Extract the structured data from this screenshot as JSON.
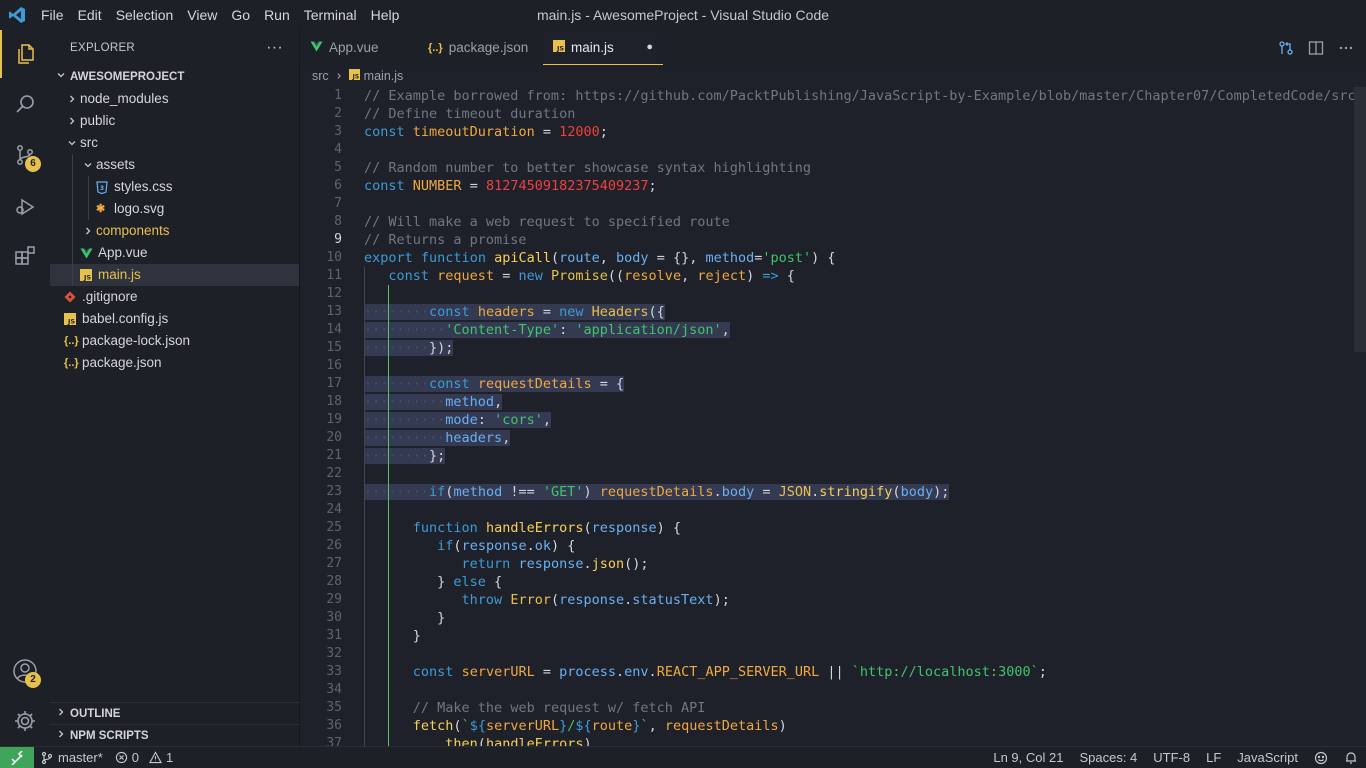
{
  "titlebar": {
    "menus": [
      "File",
      "Edit",
      "Selection",
      "View",
      "Go",
      "Run",
      "Terminal",
      "Help"
    ],
    "title": "main.js - AwesomeProject - Visual Studio Code"
  },
  "activity": {
    "scm_badge": "6",
    "accounts_badge": "2"
  },
  "sidebar": {
    "title": "EXPLORER",
    "more": "···",
    "project": "AWESOMEPROJECT",
    "tree": [
      {
        "label": "node_modules"
      },
      {
        "label": "public"
      },
      {
        "label": "src"
      },
      {
        "label": "assets"
      },
      {
        "label": "styles.css"
      },
      {
        "label": "logo.svg"
      },
      {
        "label": "components"
      },
      {
        "label": "App.vue"
      },
      {
        "label": "main.js"
      },
      {
        "label": ".gitignore"
      },
      {
        "label": "babel.config.js"
      },
      {
        "label": "package-lock.json"
      },
      {
        "label": "package.json"
      }
    ],
    "outline": "OUTLINE",
    "npm": "NPM SCRIPTS"
  },
  "tabs": [
    {
      "label": "App.vue"
    },
    {
      "label": "package.json"
    },
    {
      "label": "main.js",
      "dirty": "●"
    }
  ],
  "breadcrumb": {
    "folder": "src",
    "file": "main.js"
  },
  "status": {
    "branch": "master*",
    "errors": "0",
    "warnings": "1",
    "position": "Ln 9, Col 21",
    "spaces": "Spaces: 4",
    "encoding": "UTF-8",
    "eol": "LF",
    "language": "JavaScript"
  },
  "colors": {
    "accent": "#e7c14a",
    "remote": "#3fa55a",
    "background": "#1e2129"
  },
  "code": [
    [
      [
        "c-com",
        "// Example borrowed from: https://github.com/PacktPublishing/JavaScript-by-Example/blob/master/Chapter07/CompletedCode/src/se"
      ]
    ],
    [
      [
        "c-com",
        "// Define timeout duration"
      ]
    ],
    [
      [
        "c-kw",
        "const"
      ],
      [
        "",
        " "
      ],
      [
        "c-var",
        "timeoutDuration"
      ],
      [
        "",
        " = "
      ],
      [
        "c-num",
        "12000"
      ],
      [
        "",
        ";"
      ]
    ],
    [],
    [
      [
        "c-com",
        "// Random number to better showcase syntax highlighting"
      ]
    ],
    [
      [
        "c-kw",
        "const"
      ],
      [
        "",
        " "
      ],
      [
        "c-var",
        "NUMBER"
      ],
      [
        "",
        " = "
      ],
      [
        "c-num",
        "812745091823754092З7"
      ]
    ],
    [],
    [
      [
        "c-com",
        "// Will make a web request to specified route"
      ]
    ],
    [
      [
        "c-com",
        "// Returns a promise"
      ]
    ],
    [
      [
        "c-kw",
        "export"
      ],
      [
        "",
        " "
      ],
      [
        "c-kw",
        "function"
      ],
      [
        "",
        " "
      ],
      [
        "c-fn",
        "apiCall"
      ],
      [
        "",
        "("
      ],
      [
        "c-prop",
        "route"
      ],
      [
        "",
        ", "
      ],
      [
        "c-prop",
        "body"
      ],
      [
        "",
        " = {}, "
      ],
      [
        "c-prop",
        "method"
      ],
      [
        "",
        "="
      ],
      [
        "c-str",
        "'post'"
      ],
      [
        "",
        ") {"
      ]
    ],
    [
      [
        "",
        "   "
      ],
      [
        "c-kw",
        "const"
      ],
      [
        "",
        " "
      ],
      [
        "c-var",
        "request"
      ],
      [
        "",
        " = "
      ],
      [
        "c-kw",
        "new"
      ],
      [
        "",
        " "
      ],
      [
        "c-cls",
        "Promise"
      ],
      [
        "",
        "(("
      ],
      [
        "c-var",
        "resolve"
      ],
      [
        "",
        ", "
      ],
      [
        "c-var",
        "reject"
      ],
      [
        "",
        ") "
      ],
      [
        "c-kw",
        "=>"
      ],
      [
        "",
        " {"
      ]
    ],
    [],
    [
      [
        "ws",
        "········"
      ],
      [
        "c-kw",
        "const"
      ],
      [
        "",
        " "
      ],
      [
        "c-var",
        "headers"
      ],
      [
        "",
        " = "
      ],
      [
        "c-kw",
        "new"
      ],
      [
        "",
        " "
      ],
      [
        "c-cls",
        "Headers"
      ],
      [
        "",
        "({"
      ]
    ],
    [
      [
        "ws",
        "··········"
      ],
      [
        "c-str",
        "'Content-Type'"
      ],
      [
        "",
        ": "
      ],
      [
        "c-str",
        "'application/json'"
      ],
      [
        "",
        ","
      ]
    ],
    [
      [
        "ws",
        "········"
      ],
      [
        "",
        "});"
      ]
    ],
    [],
    [
      [
        "ws",
        "········"
      ],
      [
        "c-kw",
        "const"
      ],
      [
        "",
        " "
      ],
      [
        "c-var",
        "requestDetails"
      ],
      [
        "",
        " = {"
      ]
    ],
    [
      [
        "ws",
        "··········"
      ],
      [
        "c-prop",
        "method"
      ],
      [
        "",
        ","
      ]
    ],
    [
      [
        "ws",
        "··········"
      ],
      [
        "c-prop",
        "mode"
      ],
      [
        "",
        ": "
      ],
      [
        "c-str",
        "'cors'"
      ],
      [
        "",
        ","
      ]
    ],
    [
      [
        "ws",
        "··········"
      ],
      [
        "c-prop",
        "headers"
      ],
      [
        "",
        ","
      ]
    ],
    [
      [
        "ws",
        "········"
      ],
      [
        "",
        "};"
      ]
    ],
    [],
    [
      [
        "ws",
        "········"
      ],
      [
        "c-kw",
        "if"
      ],
      [
        "",
        "("
      ],
      [
        "c-prop",
        "method"
      ],
      [
        "",
        " !== "
      ],
      [
        "c-str",
        "'GET'"
      ],
      [
        "",
        ") "
      ],
      [
        "c-var",
        "requestDetails"
      ],
      [
        "",
        "."
      ],
      [
        "c-prop",
        "body"
      ],
      [
        "",
        " = "
      ],
      [
        "c-cls",
        "JSON"
      ],
      [
        "",
        "."
      ],
      [
        "c-fn",
        "stringify"
      ],
      [
        "",
        "("
      ],
      [
        "c-prop",
        "body"
      ],
      [
        "",
        ");"
      ]
    ],
    [],
    [
      [
        "",
        "      "
      ],
      [
        "c-kw",
        "function"
      ],
      [
        "",
        " "
      ],
      [
        "c-fn",
        "handleErrors"
      ],
      [
        "",
        "("
      ],
      [
        "c-prop",
        "response"
      ],
      [
        "",
        ") {"
      ]
    ],
    [
      [
        "",
        "         "
      ],
      [
        "c-kw",
        "if"
      ],
      [
        "",
        "("
      ],
      [
        "c-prop",
        "response"
      ],
      [
        "",
        "."
      ],
      [
        "c-prop",
        "ok"
      ],
      [
        "",
        ") {"
      ]
    ],
    [
      [
        "",
        "            "
      ],
      [
        "c-kw",
        "return"
      ],
      [
        "",
        " "
      ],
      [
        "c-prop",
        "response"
      ],
      [
        "",
        "."
      ],
      [
        "c-fn",
        "json"
      ],
      [
        "",
        "();"
      ]
    ],
    [
      [
        "",
        "         } "
      ],
      [
        "c-kw",
        "else"
      ],
      [
        "",
        " {"
      ]
    ],
    [
      [
        "",
        "            "
      ],
      [
        "c-kw",
        "throw"
      ],
      [
        "",
        " "
      ],
      [
        "c-cls",
        "Error"
      ],
      [
        "",
        "("
      ],
      [
        "c-prop",
        "response"
      ],
      [
        "",
        "."
      ],
      [
        "c-prop",
        "statusText"
      ],
      [
        "",
        ");"
      ]
    ],
    [
      [
        "",
        "         }"
      ]
    ],
    [
      [
        "",
        "      }"
      ]
    ],
    [],
    [
      [
        "",
        "      "
      ],
      [
        "c-kw",
        "const"
      ],
      [
        "",
        " "
      ],
      [
        "c-var",
        "serverURL"
      ],
      [
        "",
        " = "
      ],
      [
        "c-prop",
        "process"
      ],
      [
        "",
        "."
      ],
      [
        "c-prop",
        "env"
      ],
      [
        "",
        "."
      ],
      [
        "c-var",
        "REACT_APP_SERVER_URL"
      ],
      [
        "",
        " || "
      ],
      [
        "c-tpl",
        "`http://localhost:3000`"
      ],
      [
        "",
        ";"
      ]
    ],
    [],
    [
      [
        "",
        "      "
      ],
      [
        "c-com",
        "// Make the web request w/ fetch API"
      ]
    ],
    [
      [
        "",
        "      "
      ],
      [
        "c-fn",
        "fetch"
      ],
      [
        "",
        "("
      ],
      [
        "c-tpl",
        "`"
      ],
      [
        "c-kw",
        "${"
      ],
      [
        "c-var",
        "serverURL"
      ],
      [
        "c-kw",
        "}"
      ],
      [
        "c-tpl",
        "/"
      ],
      [
        "c-kw",
        "${"
      ],
      [
        "c-var",
        "route"
      ],
      [
        "c-kw",
        "}"
      ],
      [
        "c-tpl",
        "`"
      ],
      [
        "",
        ", "
      ],
      [
        "c-var",
        "requestDetails"
      ],
      [
        "",
        ")"
      ]
    ],
    [
      [
        "",
        "         ."
      ],
      [
        "c-fn",
        "then"
      ],
      [
        "",
        "("
      ],
      [
        "c-fn",
        "handleErrors"
      ],
      [
        "",
        ")"
      ]
    ]
  ]
}
